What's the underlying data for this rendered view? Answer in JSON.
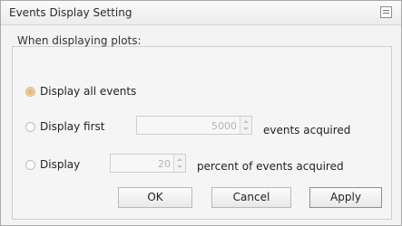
{
  "dialog": {
    "title": "Events Display Setting",
    "close_icon": "close-icon"
  },
  "group": {
    "label": "When displaying plots:"
  },
  "options": [
    {
      "label": "Display all events",
      "selected": true
    },
    {
      "label": "Display first",
      "selected": false,
      "value": "5000",
      "suffix": "events acquired"
    },
    {
      "label": "Display",
      "selected": false,
      "value": "20",
      "suffix": "percent of events acquired"
    }
  ],
  "buttons": {
    "ok": "OK",
    "cancel": "Cancel",
    "apply": "Apply"
  }
}
